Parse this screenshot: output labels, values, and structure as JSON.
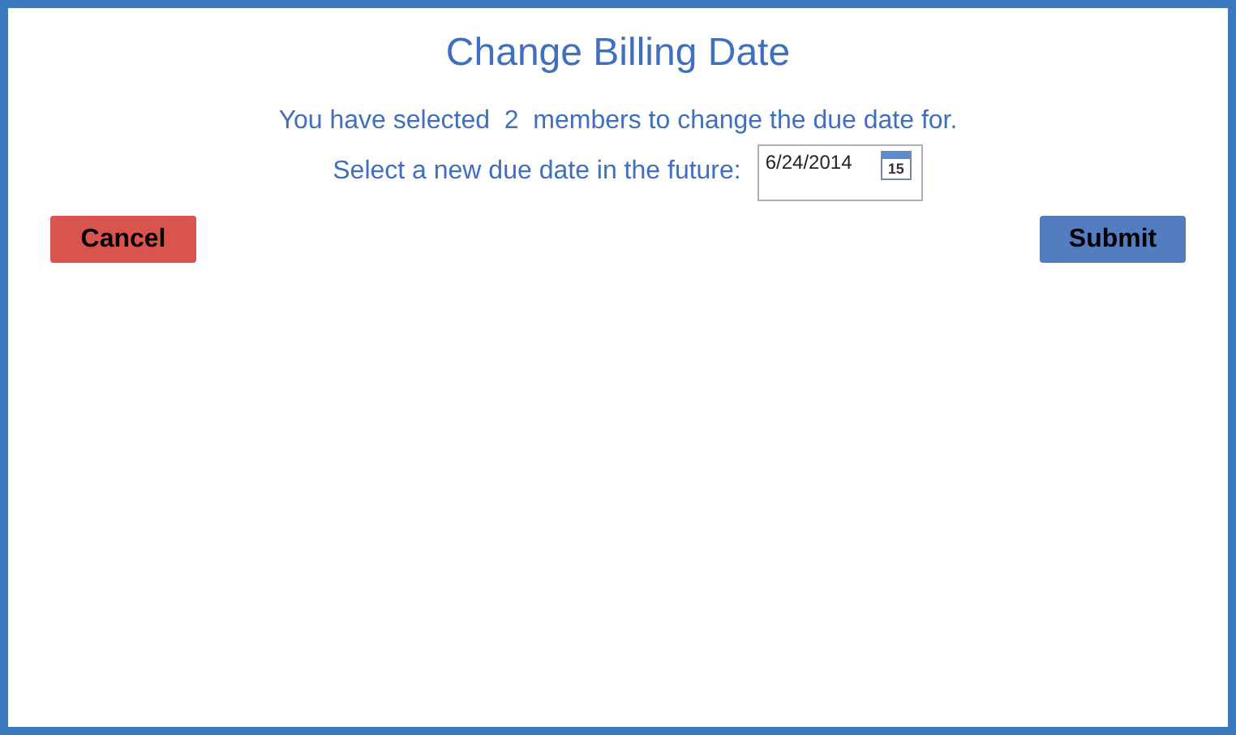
{
  "title": "Change Billing Date",
  "message": {
    "before": "You have selected",
    "count": "2",
    "after": "members to change the due date for."
  },
  "date_field": {
    "label": "Select a new due date in the future:",
    "value": "6/24/2014",
    "calendar_day": "15"
  },
  "buttons": [
    {
      "label": "Cancel",
      "kind": "cancel"
    },
    {
      "label": "Submit",
      "kind": "submit"
    }
  ]
}
